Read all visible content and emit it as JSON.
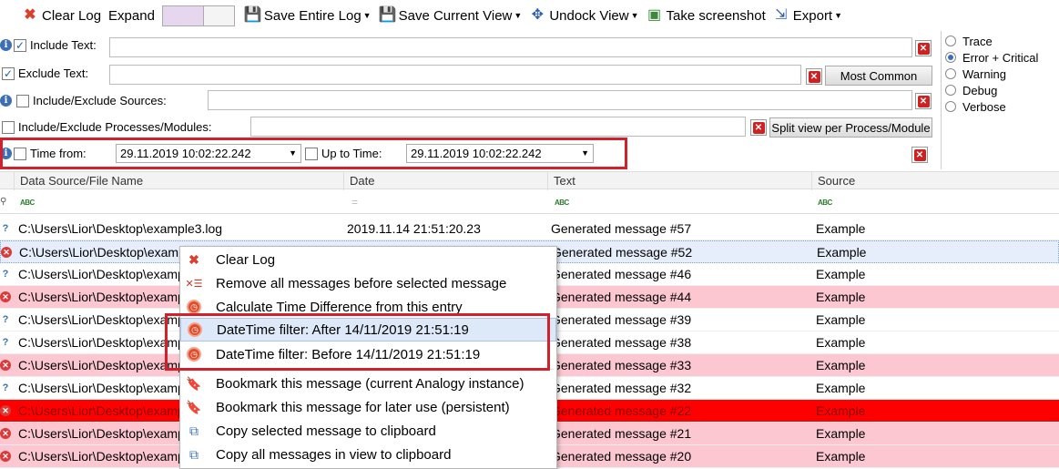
{
  "toolbar": {
    "clear_log": "Clear Log",
    "expand": "Expand",
    "save_entire_log": "Save Entire Log",
    "save_current_view": "Save Current View",
    "undock_view": "Undock View",
    "take_screenshot": "Take screenshot",
    "export": "Export"
  },
  "filters": {
    "include_text": "Include Text:",
    "exclude_text": "Exclude Text:",
    "most_common": "Most Common",
    "include_exclude_sources": "Include/Exclude Sources:",
    "include_exclude_processes": "Include/Exclude Processes/Modules:",
    "split_view": "Split view per Process/Module",
    "time_from": "Time from:",
    "time_from_value": "29.11.2019 10:02:22.242",
    "up_to_time": "Up to Time:",
    "up_to_time_value": "29.11.2019 10:02:22.242"
  },
  "levels": [
    "Trace",
    "Error + Critical",
    "Warning",
    "Debug",
    "Verbose"
  ],
  "selected_level": "Error + Critical",
  "columns": [
    "Data Source/File Name",
    "Date",
    "Text",
    "Source"
  ],
  "rows": [
    {
      "source": "C:\\Users\\Lior\\Desktop\\example3.log",
      "date": "2019.11.14 21:51:20.23",
      "text": "Generated message #57",
      "src": "Example"
    },
    {
      "source": "C:\\Users\\Lior\\Desktop\\examp",
      "date": "",
      "text": "Generated message #52",
      "src": "Example"
    },
    {
      "source": "C:\\Users\\Lior\\Desktop\\examp",
      "date": "",
      "text": "Generated message #46",
      "src": "Example"
    },
    {
      "source": "C:\\Users\\Lior\\Desktop\\examp",
      "date": "",
      "text": "Generated message #44",
      "src": "Example"
    },
    {
      "source": "C:\\Users\\Lior\\Desktop\\examp",
      "date": "",
      "text": "Generated message #39",
      "src": "Example"
    },
    {
      "source": "C:\\Users\\Lior\\Desktop\\examp",
      "date": "",
      "text": "Generated message #38",
      "src": "Example"
    },
    {
      "source": "C:\\Users\\Lior\\Desktop\\examp",
      "date": "",
      "text": "Generated message #33",
      "src": "Example"
    },
    {
      "source": "C:\\Users\\Lior\\Desktop\\examp",
      "date": "",
      "text": "Generated message #32",
      "src": "Example"
    },
    {
      "source": "C:\\Users\\Lior\\Desktop\\examp",
      "date": "",
      "text": "Generated message #22",
      "src": "Example"
    },
    {
      "source": "C:\\Users\\Lior\\Desktop\\examp",
      "date": "",
      "text": "Generated message #21",
      "src": "Example"
    },
    {
      "source": "C:\\Users\\Lior\\Desktop\\examp",
      "date": "",
      "text": "Generated message #20",
      "src": "Example"
    }
  ],
  "context_menu": [
    "Clear Log",
    "Remove all messages before selected message",
    "Calculate Time Difference from this entry",
    "DateTime filter: After 14/11/2019 21:51:19",
    "DateTime filter: Before 14/11/2019 21:51:19",
    "Bookmark this message (current Analogy instance)",
    "Bookmark this message for later use (persistent)",
    "Copy selected message to clipboard",
    "Copy all messages in view to clipboard"
  ],
  "colors": {
    "highlight_frame": "#d4202a",
    "error_row": "#fcc7d0",
    "critical_row": "#ff0000",
    "selected_row": "#e6eefb"
  }
}
